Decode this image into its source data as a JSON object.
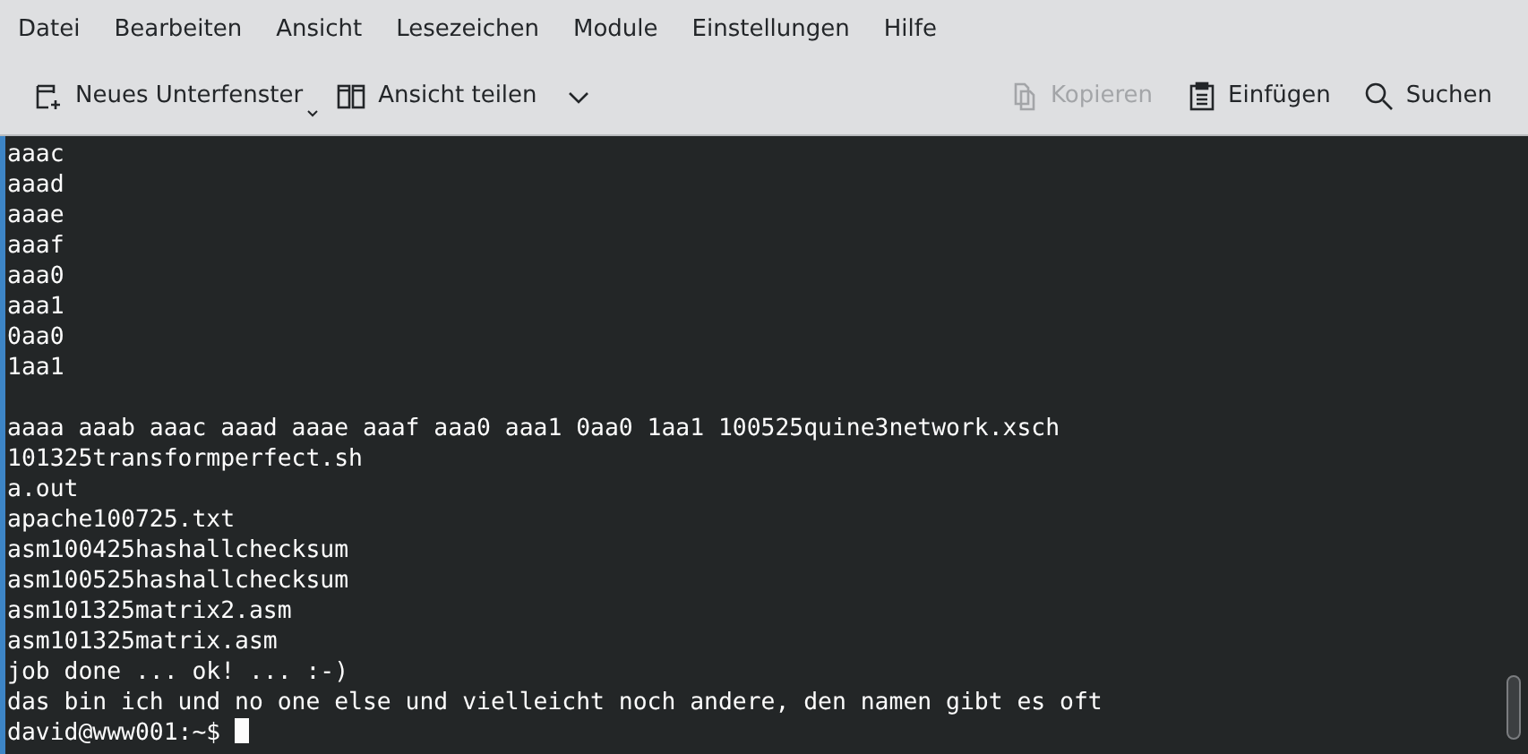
{
  "menu": [
    "Datei",
    "Bearbeiten",
    "Ansicht",
    "Lesezeichen",
    "Module",
    "Einstellungen",
    "Hilfe"
  ],
  "toolbar": {
    "left": [
      {
        "label": "Neues Unterfenster",
        "kind": "new-tab",
        "disabled": false
      },
      {
        "label": "Ansicht teilen",
        "kind": "split",
        "disabled": false
      }
    ],
    "right": [
      {
        "label": "Kopieren",
        "kind": "copy",
        "disabled": true
      },
      {
        "label": "Einfügen",
        "kind": "paste",
        "disabled": false
      },
      {
        "label": "Suchen",
        "kind": "search",
        "disabled": false
      }
    ]
  },
  "terminal": {
    "blocks": [
      [
        "aaac",
        "aaad",
        "aaae",
        "aaaf",
        "aaa0",
        "aaa1",
        "0aa0",
        "1aa1"
      ],
      [
        "aaaa aaab aaac aaad aaae aaaf aaa0 aaa1 0aa0 1aa1 100525quine3network.xsch",
        "101325transformperfect.sh",
        "a.out",
        "apache100725.txt",
        "asm100425hashallchecksum",
        "asm100525hashallchecksum",
        "asm101325matrix2.asm",
        "asm101325matrix.asm",
        "job done ... ok! ... :-)",
        "das bin ich und no one else und vielleicht noch andere, den namen gibt es oft"
      ]
    ],
    "prompt": "david@www001:~$"
  }
}
